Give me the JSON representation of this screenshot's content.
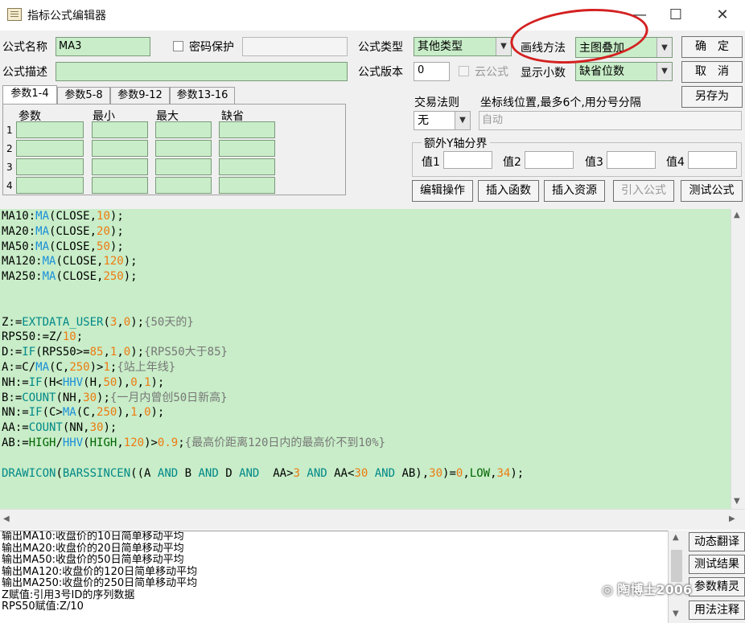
{
  "window": {
    "title": "指标公式编辑器",
    "minimize_glyph": "—",
    "maximize_glyph": "☐",
    "close_glyph": "✕"
  },
  "form": {
    "name_label": "公式名称",
    "name_value": "MA3",
    "password_label": "密码保护",
    "desc_label": "公式描述",
    "desc_value": "",
    "type_label": "公式类型",
    "type_value": "其他类型",
    "draw_label": "画线方法",
    "draw_value": "主图叠加",
    "version_label": "公式版本",
    "version_value": "0",
    "cloud_label": "云公式",
    "decimal_label": "显示小数",
    "decimal_value": "缺省位数",
    "trade_rule_label": "交易法则",
    "trade_rule_value": "无",
    "coord_label": "坐标线位置,最多6个,用分号分隔",
    "coord_value": "自动",
    "extra_axis_label": "额外Y轴分界",
    "val1_label": "值1",
    "val2_label": "值2",
    "val3_label": "值3",
    "val4_label": "值4"
  },
  "buttons": {
    "ok": "确　定",
    "cancel": "取　消",
    "save_as": "另存为",
    "edit_ops": "编辑操作",
    "insert_func": "插入函数",
    "insert_res": "插入资源",
    "import_formula": "引入公式",
    "test_formula": "测试公式"
  },
  "tabs": [
    "参数1-4",
    "参数5-8",
    "参数9-12",
    "参数13-16"
  ],
  "param_table": {
    "headers": [
      "参数",
      "最小",
      "最大",
      "缺省"
    ],
    "rows": [
      "1",
      "2",
      "3",
      "4"
    ]
  },
  "code_lines": [
    [
      [
        "MA10:",
        "n"
      ],
      [
        "MA",
        "f"
      ],
      [
        "(CLOSE,",
        "n"
      ],
      [
        "10",
        "num"
      ],
      [
        ");",
        "n"
      ]
    ],
    [
      [
        "MA20:",
        "n"
      ],
      [
        "MA",
        "f"
      ],
      [
        "(CLOSE,",
        "n"
      ],
      [
        "20",
        "num"
      ],
      [
        ");",
        "n"
      ]
    ],
    [
      [
        "MA50:",
        "n"
      ],
      [
        "MA",
        "f"
      ],
      [
        "(CLOSE,",
        "n"
      ],
      [
        "50",
        "num"
      ],
      [
        ");",
        "n"
      ]
    ],
    [
      [
        "MA120:",
        "n"
      ],
      [
        "MA",
        "f"
      ],
      [
        "(CLOSE,",
        "n"
      ],
      [
        "120",
        "num"
      ],
      [
        ");",
        "n"
      ]
    ],
    [
      [
        "MA250:",
        "n"
      ],
      [
        "MA",
        "f"
      ],
      [
        "(CLOSE,",
        "n"
      ],
      [
        "250",
        "num"
      ],
      [
        ");",
        "n"
      ]
    ],
    [],
    [],
    [
      [
        "Z:=",
        "n"
      ],
      [
        "EXTDATA_USER",
        "kw"
      ],
      [
        "(",
        "n"
      ],
      [
        "3",
        "num"
      ],
      [
        ",",
        "n"
      ],
      [
        "0",
        "num"
      ],
      [
        ");",
        "n"
      ],
      [
        "{50天的}",
        "cm"
      ]
    ],
    [
      [
        "RPS50:=Z/",
        "n"
      ],
      [
        "10",
        "num"
      ],
      [
        ";",
        "n"
      ]
    ],
    [
      [
        "D:=",
        "n"
      ],
      [
        "IF",
        "kw"
      ],
      [
        "(RPS50>=",
        "n"
      ],
      [
        "85",
        "num"
      ],
      [
        ",",
        "n"
      ],
      [
        "1",
        "num"
      ],
      [
        ",",
        "n"
      ],
      [
        "0",
        "num"
      ],
      [
        ");",
        "n"
      ],
      [
        "{RPS50大于85}",
        "cm"
      ]
    ],
    [
      [
        "A:=C/",
        "n"
      ],
      [
        "MA",
        "f"
      ],
      [
        "(C,",
        "n"
      ],
      [
        "250",
        "num"
      ],
      [
        ")>",
        "n"
      ],
      [
        "1",
        "num"
      ],
      [
        ";",
        "n"
      ],
      [
        "{站上年线}",
        "cm"
      ]
    ],
    [
      [
        "NH:=",
        "n"
      ],
      [
        "IF",
        "kw"
      ],
      [
        "(H<",
        "n"
      ],
      [
        "HHV",
        "f"
      ],
      [
        "(H,",
        "n"
      ],
      [
        "50",
        "num"
      ],
      [
        "),",
        "n"
      ],
      [
        "0",
        "num"
      ],
      [
        ",",
        "n"
      ],
      [
        "1",
        "num"
      ],
      [
        ");",
        "n"
      ]
    ],
    [
      [
        "B:=",
        "n"
      ],
      [
        "COUNT",
        "kw"
      ],
      [
        "(NH,",
        "n"
      ],
      [
        "30",
        "num"
      ],
      [
        ");",
        "n"
      ],
      [
        "{一月内曾创50日新高}",
        "cm"
      ]
    ],
    [
      [
        "NN:=",
        "n"
      ],
      [
        "IF",
        "kw"
      ],
      [
        "(C>",
        "n"
      ],
      [
        "MA",
        "f"
      ],
      [
        "(C,",
        "n"
      ],
      [
        "250",
        "num"
      ],
      [
        "),",
        "n"
      ],
      [
        "1",
        "num"
      ],
      [
        ",",
        "n"
      ],
      [
        "0",
        "num"
      ],
      [
        ");",
        "n"
      ]
    ],
    [
      [
        "AA:=",
        "n"
      ],
      [
        "COUNT",
        "kw"
      ],
      [
        "(NN,",
        "n"
      ],
      [
        "30",
        "num"
      ],
      [
        ");",
        "n"
      ]
    ],
    [
      [
        "AB:=",
        "n"
      ],
      [
        "HIGH",
        "g"
      ],
      [
        "/",
        "n"
      ],
      [
        "HHV",
        "f"
      ],
      [
        "(",
        "n"
      ],
      [
        "HIGH",
        "g"
      ],
      [
        ",",
        "n"
      ],
      [
        "120",
        "num"
      ],
      [
        ")>",
        "n"
      ],
      [
        "0.9",
        "num"
      ],
      [
        ";",
        "n"
      ],
      [
        "{最高价距离120日内的最高价不到10%}",
        "cm"
      ]
    ],
    [],
    [
      [
        "DRAWICON",
        "kw"
      ],
      [
        "(",
        "n"
      ],
      [
        "BARSSINCEN",
        "kw"
      ],
      [
        "((A ",
        "n"
      ],
      [
        "AND",
        "kw"
      ],
      [
        " B ",
        "n"
      ],
      [
        "AND",
        "kw"
      ],
      [
        " D ",
        "n"
      ],
      [
        "AND",
        "kw"
      ],
      [
        "  AA>",
        "n"
      ],
      [
        "3",
        "num"
      ],
      [
        " ",
        "n"
      ],
      [
        "AND",
        "kw"
      ],
      [
        " AA<",
        "n"
      ],
      [
        "30",
        "num"
      ],
      [
        " ",
        "n"
      ],
      [
        "AND",
        "kw"
      ],
      [
        " AB),",
        "n"
      ],
      [
        "30",
        "num"
      ],
      [
        ")=",
        "n"
      ],
      [
        "0",
        "num"
      ],
      [
        ",",
        "n"
      ],
      [
        "LOW",
        "g"
      ],
      [
        ",",
        "n"
      ],
      [
        "34",
        "num"
      ],
      [
        ");",
        "n"
      ]
    ]
  ],
  "output_lines": [
    "输出MA10:收盘价的10日简单移动平均",
    "输出MA20:收盘价的20日简单移动平均",
    "输出MA50:收盘价的50日简单移动平均",
    "输出MA120:收盘价的120日简单移动平均",
    "输出MA250:收盘价的250日简单移动平均",
    "Z赋值:引用3号ID的序列数据",
    "RPS50赋值:Z/10"
  ],
  "side_buttons": {
    "dynamic_translate": "动态翻译",
    "test_result": "测试结果",
    "param_wizard": "参数精灵",
    "usage_note": "用法注释"
  },
  "watermark": "陶博士2006",
  "colors": {
    "editor_bg": "#c8edc8",
    "function": "#1a8fd8",
    "number": "#ee7a10",
    "comment": "#777777",
    "keyword": "#008888",
    "annotation_ellipse": "#d42020"
  }
}
